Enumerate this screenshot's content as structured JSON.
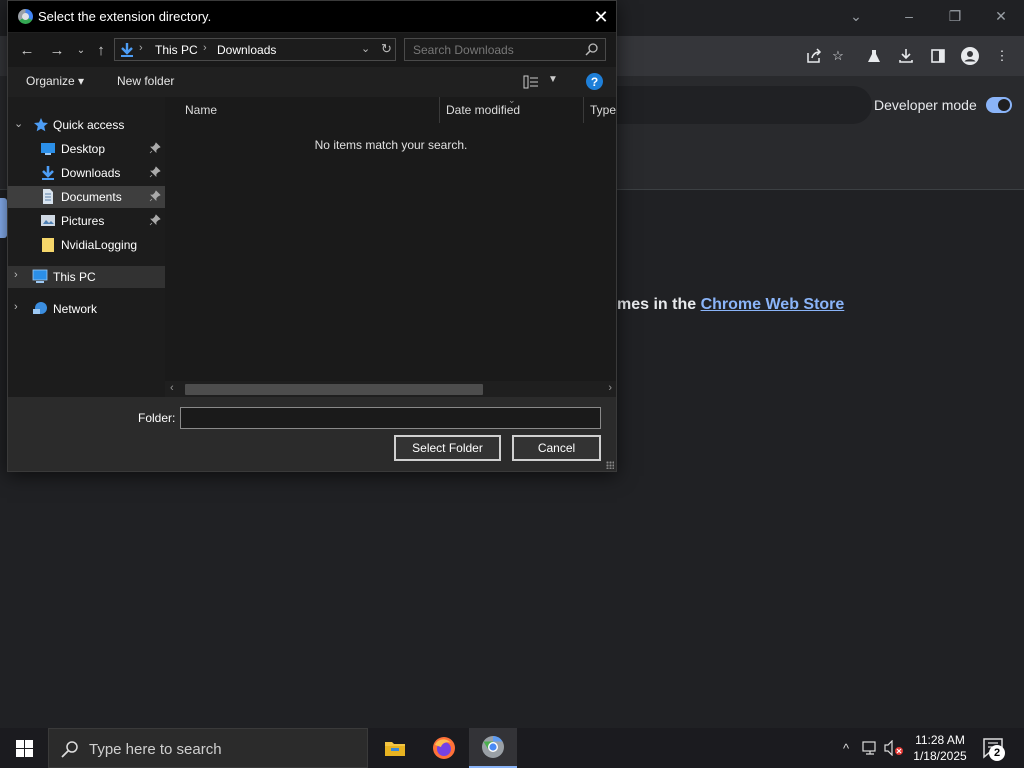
{
  "dialog": {
    "title": "Select the extension directory.",
    "close_icon": "close-icon",
    "address": {
      "crumbs": [
        "This PC",
        "Downloads"
      ],
      "refresh_icon": "refresh-icon"
    },
    "search": {
      "placeholder": "Search Downloads"
    },
    "commands": {
      "organize": "Organize ▾",
      "new_folder": "New folder"
    },
    "nav_pane": {
      "quick_access": "Quick access",
      "items": [
        {
          "label": "Desktop",
          "pinned": true
        },
        {
          "label": "Downloads",
          "pinned": true
        },
        {
          "label": "Documents",
          "pinned": true,
          "selected": true
        },
        {
          "label": "Pictures",
          "pinned": true
        },
        {
          "label": "NvidiaLogging",
          "pinned": false
        }
      ],
      "this_pc": "This PC",
      "network": "Network"
    },
    "columns": [
      "Name",
      "Date modified",
      "Type"
    ],
    "empty_message": "No items match your search.",
    "folder_label": "Folder:",
    "folder_value": "",
    "buttons": {
      "select": "Select Folder",
      "cancel": "Cancel"
    }
  },
  "chrome": {
    "developer_mode_label": "Developer mode",
    "developer_mode_on": true,
    "webstore_prefix": "mes in the ",
    "webstore_link": "Chrome Web Store",
    "accent": "#8ab4f8"
  },
  "taskbar": {
    "search_text": "Type here to search",
    "apps": [
      "file-explorer-icon",
      "firefox-icon",
      "chrome-icon"
    ],
    "time": "11:28 AM",
    "date": "1/18/2025",
    "notification_count": "2"
  }
}
